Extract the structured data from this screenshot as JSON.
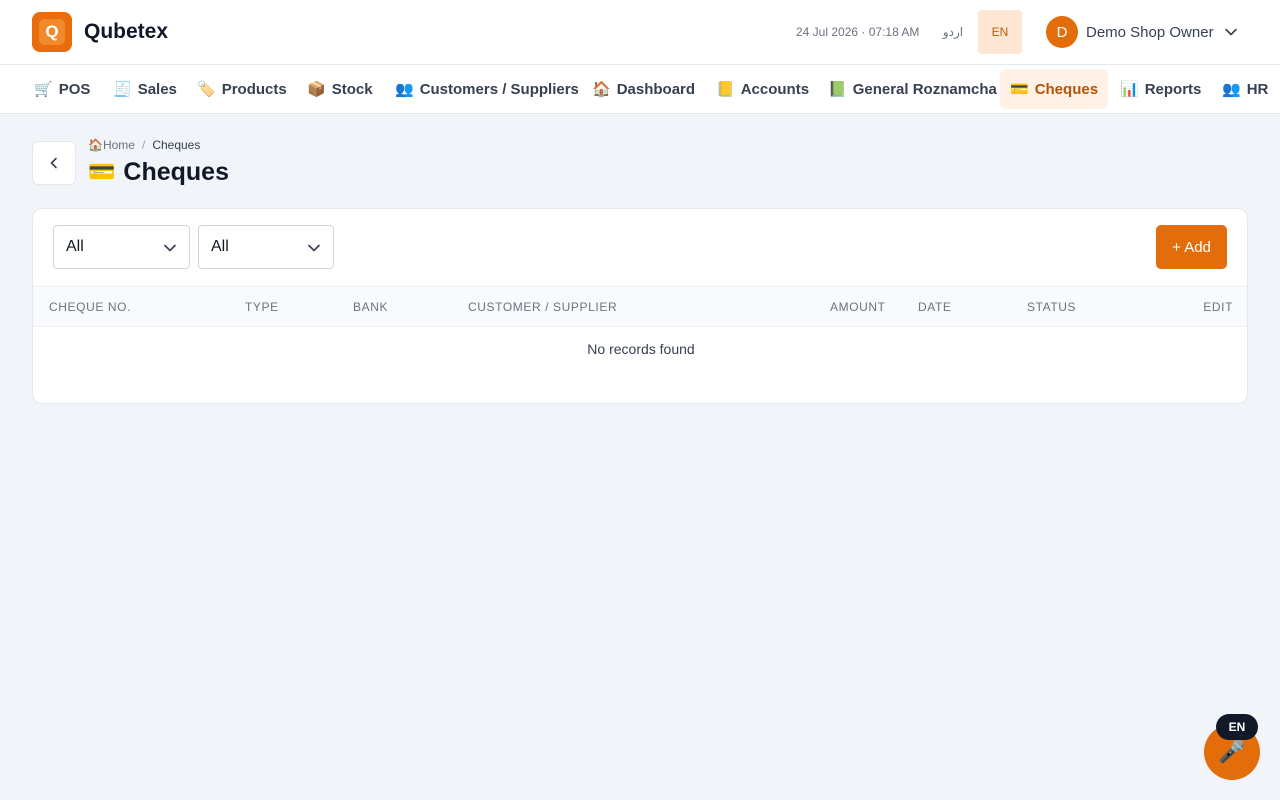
{
  "header": {
    "logo_letter": "Q",
    "brand": "Qubetex",
    "datetime": "24 Jul 2026 · 07:18 AM",
    "lang_urdu": "اردو",
    "lang_en": "EN",
    "user": {
      "initial": "D",
      "name": "Demo Shop Owner"
    }
  },
  "nav": {
    "items": [
      {
        "icon": "🛒",
        "label": "POS"
      },
      {
        "icon": "🧾",
        "label": "Sales"
      },
      {
        "icon": "🏷️",
        "label": "Products"
      },
      {
        "icon": "📦",
        "label": "Stock"
      },
      {
        "icon": "👥",
        "label": "Customers / Suppliers"
      },
      {
        "icon": "🏠",
        "label": "Dashboard"
      },
      {
        "icon": "📒",
        "label": "Accounts"
      },
      {
        "icon": "📗",
        "label": "General Roznamcha"
      },
      {
        "icon": "💳",
        "label": "Cheques",
        "active": true
      },
      {
        "icon": "📊",
        "label": "Reports"
      },
      {
        "icon": "👥",
        "label": "HR"
      }
    ]
  },
  "breadcrumb": {
    "home_icon": "🏠",
    "home": "Home",
    "separator": "/",
    "current": "Cheques"
  },
  "page": {
    "title_icon": "💳",
    "title": "Cheques"
  },
  "filters": {
    "type_selected": "All",
    "status_selected": "All"
  },
  "add_button": "+ Add",
  "table": {
    "columns": [
      "CHEQUE NO.",
      "TYPE",
      "BANK",
      "CUSTOMER / SUPPLIER",
      "AMOUNT",
      "DATE",
      "STATUS",
      "EDIT"
    ],
    "empty_message": "No records found"
  },
  "voice": {
    "icon": "🎤",
    "lang_badge": "EN"
  },
  "colors": {
    "accent": "#e36d0a",
    "background": "#f1f4f9",
    "active_tab_bg": "#fff1e6"
  }
}
